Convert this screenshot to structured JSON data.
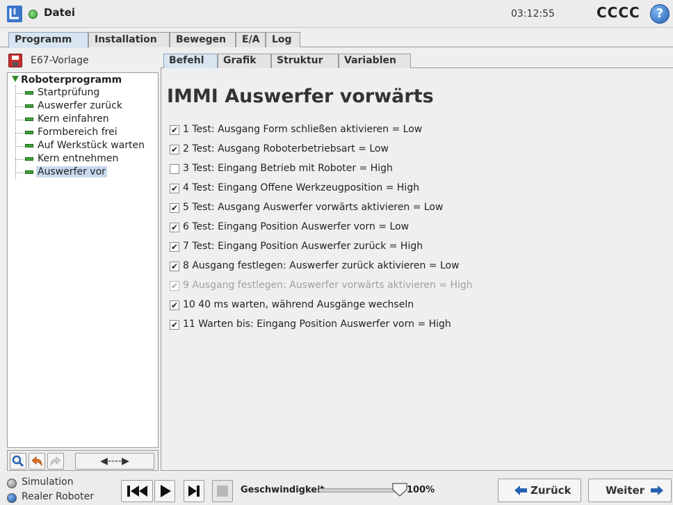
{
  "titlebar": {
    "title": "Datei",
    "clock": "03:12:55",
    "robot_name": "CCCC",
    "help_label": "?"
  },
  "main_tabs": [
    "Programm",
    "Installation",
    "Bewegen",
    "E/A",
    "Log"
  ],
  "program_file": "E67-Vorlage",
  "tree": {
    "root": "Roboterprogramm",
    "items": [
      "Startprüfung",
      "Auswerfer zurück",
      "Kern einfahren",
      "Formbereich frei",
      "Auf Werkstück warten",
      "Kern entnehmen",
      "Auswerfer vor"
    ],
    "selected_index": 6
  },
  "tree_toolbar": {
    "move_label": "◀----▶"
  },
  "sub_tabs": [
    "Befehl",
    "Grafik",
    "Struktur",
    "Variablen"
  ],
  "command": {
    "heading": "IMMI Auswerfer vorwärts",
    "lines": [
      {
        "text": "1 Test: Ausgang Form schließen aktivieren = Low",
        "checked": true,
        "disabled": false
      },
      {
        "text": "2 Test: Ausgang Roboterbetriebsart = Low",
        "checked": true,
        "disabled": false
      },
      {
        "text": "3 Test: Eingang Betrieb mit Roboter = High",
        "checked": false,
        "disabled": false
      },
      {
        "text": "4 Test: Eingang Offene Werkzeugposition = High",
        "checked": true,
        "disabled": false
      },
      {
        "text": "5 Test: Ausgang Auswerfer vorwärts aktivieren = Low",
        "checked": true,
        "disabled": false
      },
      {
        "text": "6 Test: Eingang Position Auswerfer vorn = Low",
        "checked": true,
        "disabled": false
      },
      {
        "text": "7 Test: Eingang Position Auswerfer zurück = High",
        "checked": true,
        "disabled": false
      },
      {
        "text": "8 Ausgang festlegen: Auswerfer zurück aktivieren = Low",
        "checked": true,
        "disabled": false
      },
      {
        "text": "9 Ausgang festlegen: Auswerfer vorwärts aktivieren = High",
        "checked": true,
        "disabled": true
      },
      {
        "text": "10 40 ms warten, während Ausgänge wechseln",
        "checked": true,
        "disabled": false
      },
      {
        "text": "11 Warten bis: Eingang Position Auswerfer vorn = High",
        "checked": true,
        "disabled": false
      }
    ]
  },
  "bottom": {
    "mode_simulation": "Simulation",
    "mode_real": "Realer Roboter",
    "speed_label": "Geschwindigkeit",
    "speed_value": "100%",
    "speed_fraction": 1.0,
    "back_label": "Zurück",
    "next_label": "Weiter"
  },
  "colors": {
    "accent": "#2560b3",
    "node_green": "#3aa63a",
    "selected_row": "#c9d9ef",
    "active_tab": "#d8e5f0"
  },
  "icons": [
    "ur-logo",
    "status-dot-icon",
    "help-icon",
    "save-icon",
    "search-icon",
    "undo-icon",
    "redo-icon",
    "skip-back-icon",
    "play-icon",
    "step-icon",
    "stop-icon",
    "arrow-left-icon",
    "arrow-right-icon"
  ]
}
